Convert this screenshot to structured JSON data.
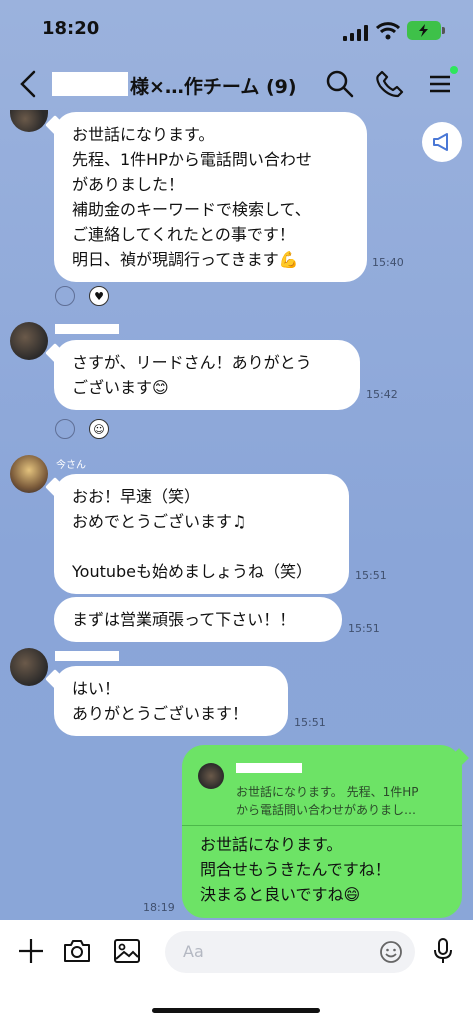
{
  "status": {
    "time": "18:20"
  },
  "header": {
    "title": "様×…作チーム (9)"
  },
  "messages": [
    {
      "text": "お世話になります。\n先程、1件HPから電話問い合わせ\nがありました！\n補助金のキーワードで検索して、\nご連絡してくれたとの事です！\n明日、禎が現調行ってきます💪",
      "time": "15:40"
    },
    {
      "text": "さすが、リードさん！ありがとう\nございます😊",
      "time": "15:42"
    },
    {
      "sender": "今さん",
      "text": "おお！早速（笑）\nおめでとうございます♫\n\nYoutubeも始めましょうね（笑）",
      "time": "15:51"
    },
    {
      "text": "まずは営業頑張って下さい！！",
      "time": "15:51"
    },
    {
      "text": "はい！\nありがとうございます！",
      "time": "15:51"
    }
  ],
  "my_message": {
    "reply_quote": "お世話になります。 先程、1件HP\nから電話問い合わせがありまし…",
    "text": "お世話になります。\n問合せもうきたんですね！\n決まると良いですね😄",
    "time": "18:19"
  },
  "input": {
    "placeholder": "Aa"
  },
  "colors": {
    "chat_bg": "#8aa6d6",
    "my_bubble": "#6de366",
    "battery": "#3ec149",
    "online_dot": "#2ee65c"
  }
}
